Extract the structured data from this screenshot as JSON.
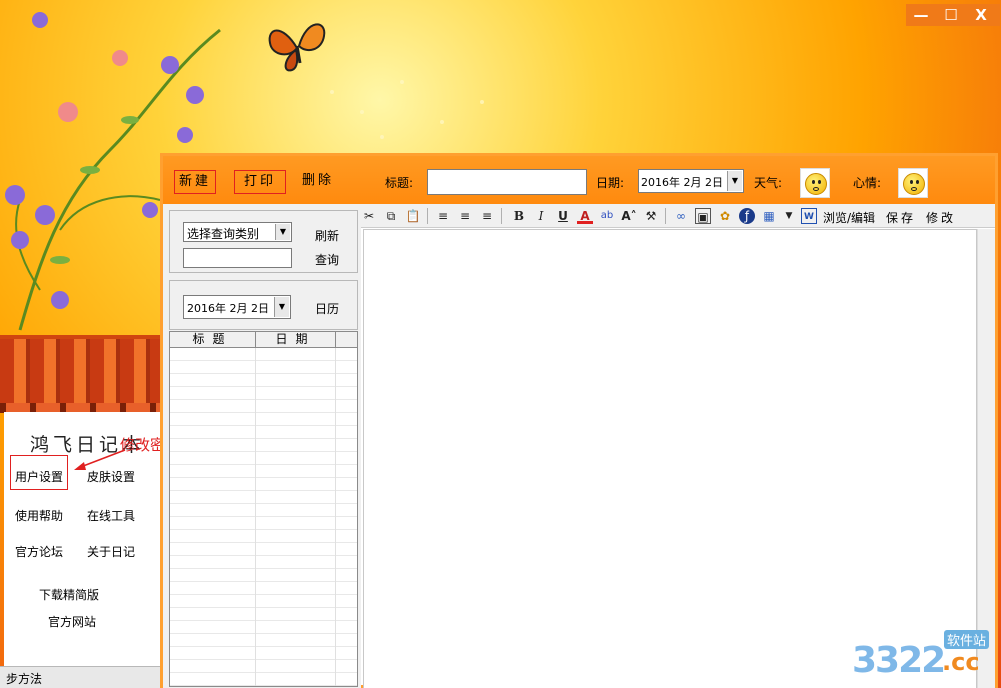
{
  "window": {
    "controls": {
      "minimize": "—",
      "maximize": "☐",
      "close": "X"
    },
    "status_text": "步方法"
  },
  "left_panel": {
    "logo_text": "鸿飞日记本",
    "annotation": "修改密码点这里",
    "menu": {
      "user_settings": "用户设置",
      "skin_settings": "皮肤设置",
      "help": "使用帮助",
      "online_tools": "在线工具",
      "forum": "官方论坛",
      "about": "关于日记",
      "download_lite": "下载精简版",
      "website": "官方网站"
    }
  },
  "toolbar": {
    "new_label": "新建",
    "print_label": "打印",
    "delete_label": "删除",
    "title_label": "标题:",
    "title_value": "",
    "date_label": "日期:",
    "date_value": "2016年 2月 2日",
    "weather_label": "天气:",
    "mood_label": "心情:"
  },
  "sidebar": {
    "query_type_select": "选择查询类别",
    "query_input_value": "",
    "refresh_label": "刷新",
    "query_label": "查询",
    "calendar_date": "2016年 2月 2日",
    "calendar_label": "日历",
    "list_columns": [
      "标题",
      "日期"
    ]
  },
  "editor": {
    "browse_edit_label": "浏览/编辑",
    "save_label": "保存",
    "modify_label": "修改"
  },
  "watermark": {
    "number": "3322",
    "domain": ".cc",
    "site_label": "软件站"
  },
  "colors": {
    "toolbar": "#ff8a0e",
    "window_border": "#ffa030",
    "annotation": "#e02020"
  }
}
